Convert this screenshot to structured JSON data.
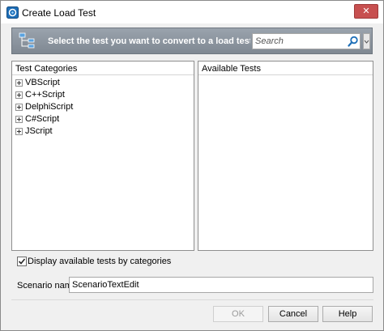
{
  "window": {
    "title": "Create Load Test",
    "close_glyph": "✕"
  },
  "banner": {
    "text": "Select the test you want to convert to a load test an",
    "search": {
      "placeholder": "Search"
    }
  },
  "categories_panel": {
    "header": "Test Categories",
    "items": [
      "VBScript",
      "C++Script",
      "DelphiScript",
      "C#Script",
      "JScript"
    ]
  },
  "tests_panel": {
    "header": "Available Tests"
  },
  "options": {
    "display_by_categories_label": "Display available tests by categories",
    "display_by_categories_checked": true
  },
  "scenario": {
    "label": "Scenario name:",
    "value": "ScenarioTextEdit"
  },
  "buttons": {
    "ok": "OK",
    "cancel": "Cancel",
    "help": "Help"
  },
  "colors": {
    "banner": "#8a939d",
    "close_button": "#c75050",
    "accent_icon": "#1e6fb8"
  }
}
